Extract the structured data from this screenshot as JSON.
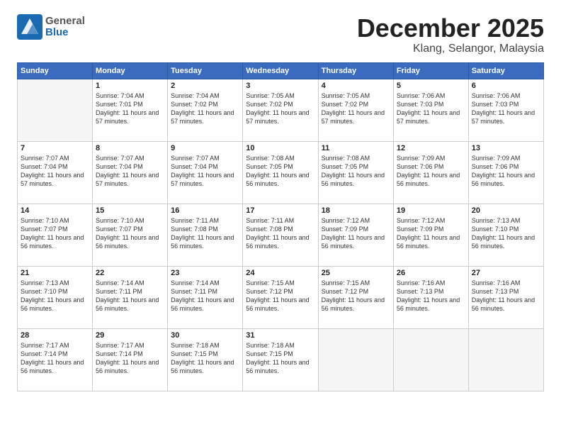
{
  "header": {
    "logo_general": "General",
    "logo_blue": "Blue",
    "month": "December 2025",
    "location": "Klang, Selangor, Malaysia"
  },
  "weekdays": [
    "Sunday",
    "Monday",
    "Tuesday",
    "Wednesday",
    "Thursday",
    "Friday",
    "Saturday"
  ],
  "weeks": [
    [
      {
        "day": "",
        "sunrise": "",
        "sunset": "",
        "daylight": "",
        "empty": true
      },
      {
        "day": "1",
        "sunrise": "Sunrise: 7:04 AM",
        "sunset": "Sunset: 7:01 PM",
        "daylight": "Daylight: 11 hours and 57 minutes."
      },
      {
        "day": "2",
        "sunrise": "Sunrise: 7:04 AM",
        "sunset": "Sunset: 7:02 PM",
        "daylight": "Daylight: 11 hours and 57 minutes."
      },
      {
        "day": "3",
        "sunrise": "Sunrise: 7:05 AM",
        "sunset": "Sunset: 7:02 PM",
        "daylight": "Daylight: 11 hours and 57 minutes."
      },
      {
        "day": "4",
        "sunrise": "Sunrise: 7:05 AM",
        "sunset": "Sunset: 7:02 PM",
        "daylight": "Daylight: 11 hours and 57 minutes."
      },
      {
        "day": "5",
        "sunrise": "Sunrise: 7:06 AM",
        "sunset": "Sunset: 7:03 PM",
        "daylight": "Daylight: 11 hours and 57 minutes."
      },
      {
        "day": "6",
        "sunrise": "Sunrise: 7:06 AM",
        "sunset": "Sunset: 7:03 PM",
        "daylight": "Daylight: 11 hours and 57 minutes."
      }
    ],
    [
      {
        "day": "7",
        "sunrise": "Sunrise: 7:07 AM",
        "sunset": "Sunset: 7:04 PM",
        "daylight": "Daylight: 11 hours and 57 minutes."
      },
      {
        "day": "8",
        "sunrise": "Sunrise: 7:07 AM",
        "sunset": "Sunset: 7:04 PM",
        "daylight": "Daylight: 11 hours and 57 minutes."
      },
      {
        "day": "9",
        "sunrise": "Sunrise: 7:07 AM",
        "sunset": "Sunset: 7:04 PM",
        "daylight": "Daylight: 11 hours and 57 minutes."
      },
      {
        "day": "10",
        "sunrise": "Sunrise: 7:08 AM",
        "sunset": "Sunset: 7:05 PM",
        "daylight": "Daylight: 11 hours and 56 minutes."
      },
      {
        "day": "11",
        "sunrise": "Sunrise: 7:08 AM",
        "sunset": "Sunset: 7:05 PM",
        "daylight": "Daylight: 11 hours and 56 minutes."
      },
      {
        "day": "12",
        "sunrise": "Sunrise: 7:09 AM",
        "sunset": "Sunset: 7:06 PM",
        "daylight": "Daylight: 11 hours and 56 minutes."
      },
      {
        "day": "13",
        "sunrise": "Sunrise: 7:09 AM",
        "sunset": "Sunset: 7:06 PM",
        "daylight": "Daylight: 11 hours and 56 minutes."
      }
    ],
    [
      {
        "day": "14",
        "sunrise": "Sunrise: 7:10 AM",
        "sunset": "Sunset: 7:07 PM",
        "daylight": "Daylight: 11 hours and 56 minutes."
      },
      {
        "day": "15",
        "sunrise": "Sunrise: 7:10 AM",
        "sunset": "Sunset: 7:07 PM",
        "daylight": "Daylight: 11 hours and 56 minutes."
      },
      {
        "day": "16",
        "sunrise": "Sunrise: 7:11 AM",
        "sunset": "Sunset: 7:08 PM",
        "daylight": "Daylight: 11 hours and 56 minutes."
      },
      {
        "day": "17",
        "sunrise": "Sunrise: 7:11 AM",
        "sunset": "Sunset: 7:08 PM",
        "daylight": "Daylight: 11 hours and 56 minutes."
      },
      {
        "day": "18",
        "sunrise": "Sunrise: 7:12 AM",
        "sunset": "Sunset: 7:09 PM",
        "daylight": "Daylight: 11 hours and 56 minutes."
      },
      {
        "day": "19",
        "sunrise": "Sunrise: 7:12 AM",
        "sunset": "Sunset: 7:09 PM",
        "daylight": "Daylight: 11 hours and 56 minutes."
      },
      {
        "day": "20",
        "sunrise": "Sunrise: 7:13 AM",
        "sunset": "Sunset: 7:10 PM",
        "daylight": "Daylight: 11 hours and 56 minutes."
      }
    ],
    [
      {
        "day": "21",
        "sunrise": "Sunrise: 7:13 AM",
        "sunset": "Sunset: 7:10 PM",
        "daylight": "Daylight: 11 hours and 56 minutes."
      },
      {
        "day": "22",
        "sunrise": "Sunrise: 7:14 AM",
        "sunset": "Sunset: 7:11 PM",
        "daylight": "Daylight: 11 hours and 56 minutes."
      },
      {
        "day": "23",
        "sunrise": "Sunrise: 7:14 AM",
        "sunset": "Sunset: 7:11 PM",
        "daylight": "Daylight: 11 hours and 56 minutes."
      },
      {
        "day": "24",
        "sunrise": "Sunrise: 7:15 AM",
        "sunset": "Sunset: 7:12 PM",
        "daylight": "Daylight: 11 hours and 56 minutes."
      },
      {
        "day": "25",
        "sunrise": "Sunrise: 7:15 AM",
        "sunset": "Sunset: 7:12 PM",
        "daylight": "Daylight: 11 hours and 56 minutes."
      },
      {
        "day": "26",
        "sunrise": "Sunrise: 7:16 AM",
        "sunset": "Sunset: 7:13 PM",
        "daylight": "Daylight: 11 hours and 56 minutes."
      },
      {
        "day": "27",
        "sunrise": "Sunrise: 7:16 AM",
        "sunset": "Sunset: 7:13 PM",
        "daylight": "Daylight: 11 hours and 56 minutes."
      }
    ],
    [
      {
        "day": "28",
        "sunrise": "Sunrise: 7:17 AM",
        "sunset": "Sunset: 7:14 PM",
        "daylight": "Daylight: 11 hours and 56 minutes."
      },
      {
        "day": "29",
        "sunrise": "Sunrise: 7:17 AM",
        "sunset": "Sunset: 7:14 PM",
        "daylight": "Daylight: 11 hours and 56 minutes."
      },
      {
        "day": "30",
        "sunrise": "Sunrise: 7:18 AM",
        "sunset": "Sunset: 7:15 PM",
        "daylight": "Daylight: 11 hours and 56 minutes."
      },
      {
        "day": "31",
        "sunrise": "Sunrise: 7:18 AM",
        "sunset": "Sunset: 7:15 PM",
        "daylight": "Daylight: 11 hours and 56 minutes."
      },
      {
        "day": "",
        "sunrise": "",
        "sunset": "",
        "daylight": "",
        "empty": true
      },
      {
        "day": "",
        "sunrise": "",
        "sunset": "",
        "daylight": "",
        "empty": true
      },
      {
        "day": "",
        "sunrise": "",
        "sunset": "",
        "daylight": "",
        "empty": true
      }
    ]
  ]
}
